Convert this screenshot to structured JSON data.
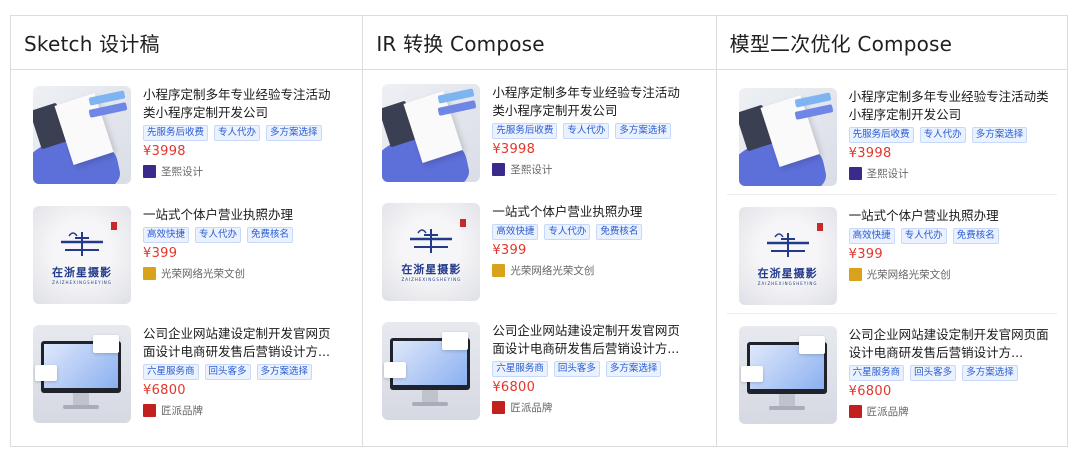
{
  "columns": [
    {
      "title": "Sketch 设计稿",
      "cards": [
        {
          "title": "小程序定制多年专业经验专注活动类小程序定制开发公司",
          "tags": [
            "先服务后收费",
            "专人代办",
            "多方案选择"
          ],
          "price": "¥3998",
          "shop": "圣熙设计",
          "logo_color": "#3b2a8c",
          "art": "mockup"
        },
        {
          "title": "一站式个体户营业执照办理",
          "tags": [
            "高效快捷",
            "专人代办",
            "免费核名"
          ],
          "price": "¥399",
          "shop": "光荣网络光荣文创",
          "logo_color": "#d9a21b",
          "art": "logo"
        },
        {
          "title": "公司企业网站建设定制开发官网页面设计电商研发售后营销设计方...",
          "tags": [
            "六星服务商",
            "回头客多",
            "多方案选择"
          ],
          "price": "¥6800",
          "shop": "匠派品牌",
          "logo_color": "#c21f1f",
          "art": "monitor"
        }
      ]
    },
    {
      "title": "IR 转换 Compose",
      "cards": [
        {
          "title": "小程序定制多年专业经验专注活动类小程序定制开发公司",
          "tags": [
            "先服务后收费",
            "专人代办",
            "多方案选择"
          ],
          "price": "¥3998",
          "shop": "圣熙设计",
          "logo_color": "#3b2a8c",
          "art": "mockup"
        },
        {
          "title": "一站式个体户营业执照办理",
          "tags": [
            "高效快捷",
            "专人代办",
            "免费核名"
          ],
          "price": "¥399",
          "shop": "光荣网络光荣文创",
          "logo_color": "#d9a21b",
          "art": "logo"
        },
        {
          "title": "公司企业网站建设定制开发官网页面设计电商研发售后营销设计方...",
          "tags": [
            "六星服务商",
            "回头客多",
            "多方案选择"
          ],
          "price": "¥6800",
          "shop": "匠派品牌",
          "logo_color": "#c21f1f",
          "art": "monitor"
        }
      ]
    },
    {
      "title": "模型二次优化 Compose",
      "cards": [
        {
          "title": "小程序定制多年专业经验专注活动类小程序定制开发公司",
          "tags": [
            "先服务后收费",
            "专人代办",
            "多方案选择"
          ],
          "price": "¥3998",
          "shop": "圣熙设计",
          "logo_color": "#3b2a8c",
          "art": "mockup"
        },
        {
          "title": "一站式个体户营业执照办理",
          "tags": [
            "高效快捷",
            "专人代办",
            "免费核名"
          ],
          "price": "¥399",
          "shop": "光荣网络光荣文创",
          "logo_color": "#d9a21b",
          "art": "logo"
        },
        {
          "title": "公司企业网站建设定制开发官网页面设计电商研发售后营销设计方...",
          "tags": [
            "六星服务商",
            "回头客多",
            "多方案选择"
          ],
          "price": "¥6800",
          "shop": "匠派品牌",
          "logo_color": "#c21f1f",
          "art": "monitor"
        }
      ]
    }
  ],
  "art_text": {
    "brand": "在浙星摄影",
    "brand_sub": "ZAIZHEXINGSHEYING"
  },
  "colors": {
    "price": "#e5352b",
    "tag_text": "#2a5ccf",
    "tag_bg": "#eaf1ff",
    "border": "#dcdcdc"
  }
}
